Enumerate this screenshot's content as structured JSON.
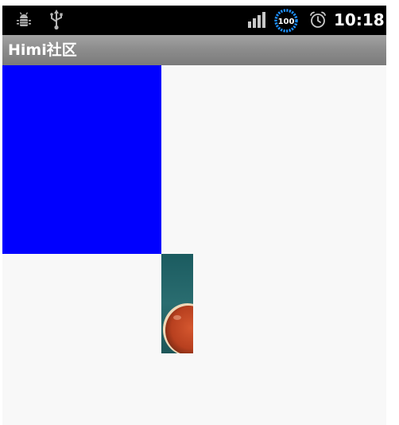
{
  "status_bar": {
    "time": "10:18",
    "battery_level": "100",
    "icons": [
      "debug-icon",
      "usb-icon",
      "signal-icon",
      "battery-icon",
      "alarm-icon"
    ],
    "background_color": "#000000",
    "battery_ring_color": "#1e90ff"
  },
  "app": {
    "title": "Himi社区",
    "title_bar_color": "#8e8e8e"
  },
  "canvas": {
    "background_color": "#f8f8f8",
    "shapes": [
      {
        "kind": "rectangle",
        "fill": "#0000ff"
      },
      {
        "kind": "sprite-image",
        "depicts": "red sphere on teal background"
      }
    ]
  }
}
